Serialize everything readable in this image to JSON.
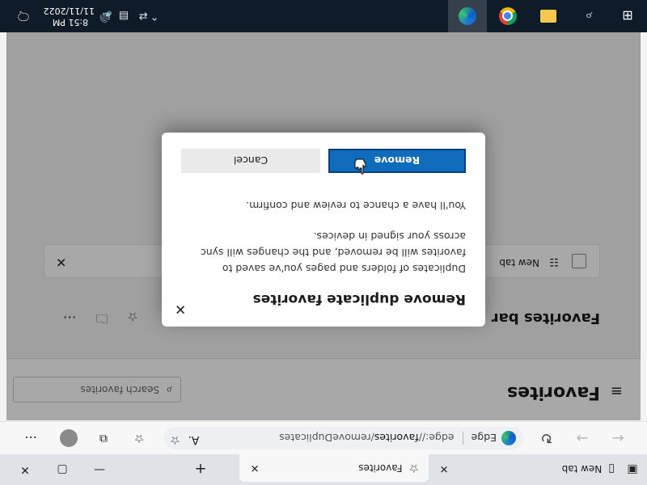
{
  "browser": {
    "tabs": [
      {
        "label": "New tab"
      },
      {
        "label": "Favorites"
      }
    ],
    "new_tab_button": "+",
    "window_controls": [
      "minimize",
      "maximize",
      "close"
    ],
    "address": {
      "edge_label": "Edge",
      "url_prefix": "edge://",
      "url_host": "favorites",
      "url_path": "/removeDuplicates"
    }
  },
  "favorites_page": {
    "title": "Favorites",
    "search_placeholder": "Search favorites",
    "section_title": "Favorites bar",
    "items": [
      {
        "label": "New tab"
      }
    ],
    "more_label": "⋯"
  },
  "dialog": {
    "title": "Remove duplicate favorites",
    "body": "Duplicates of folders and pages you've saved to favorites will be removed, and the changes will sync across your signed in devices.",
    "note": "You'll have a chance to review and confirm.",
    "primary_button": "Remove",
    "secondary_button": "Cancel"
  },
  "taskbar": {
    "time": "8:51 PM",
    "date": "11/11/2022"
  },
  "icons": {
    "back": "arrow-left-icon",
    "forward": "arrow-right-icon",
    "refresh": "refresh-icon",
    "edge": "edge-icon",
    "read_aloud": "read-aloud-icon",
    "add_favorite": "add-favorite-icon",
    "favorites": "favorites-icon",
    "collections": "collections-icon",
    "profile": "profile-icon",
    "settings_more": "more-icon"
  },
  "colors": {
    "accent": "#0f6cbd",
    "taskbar": "#101b2a"
  }
}
